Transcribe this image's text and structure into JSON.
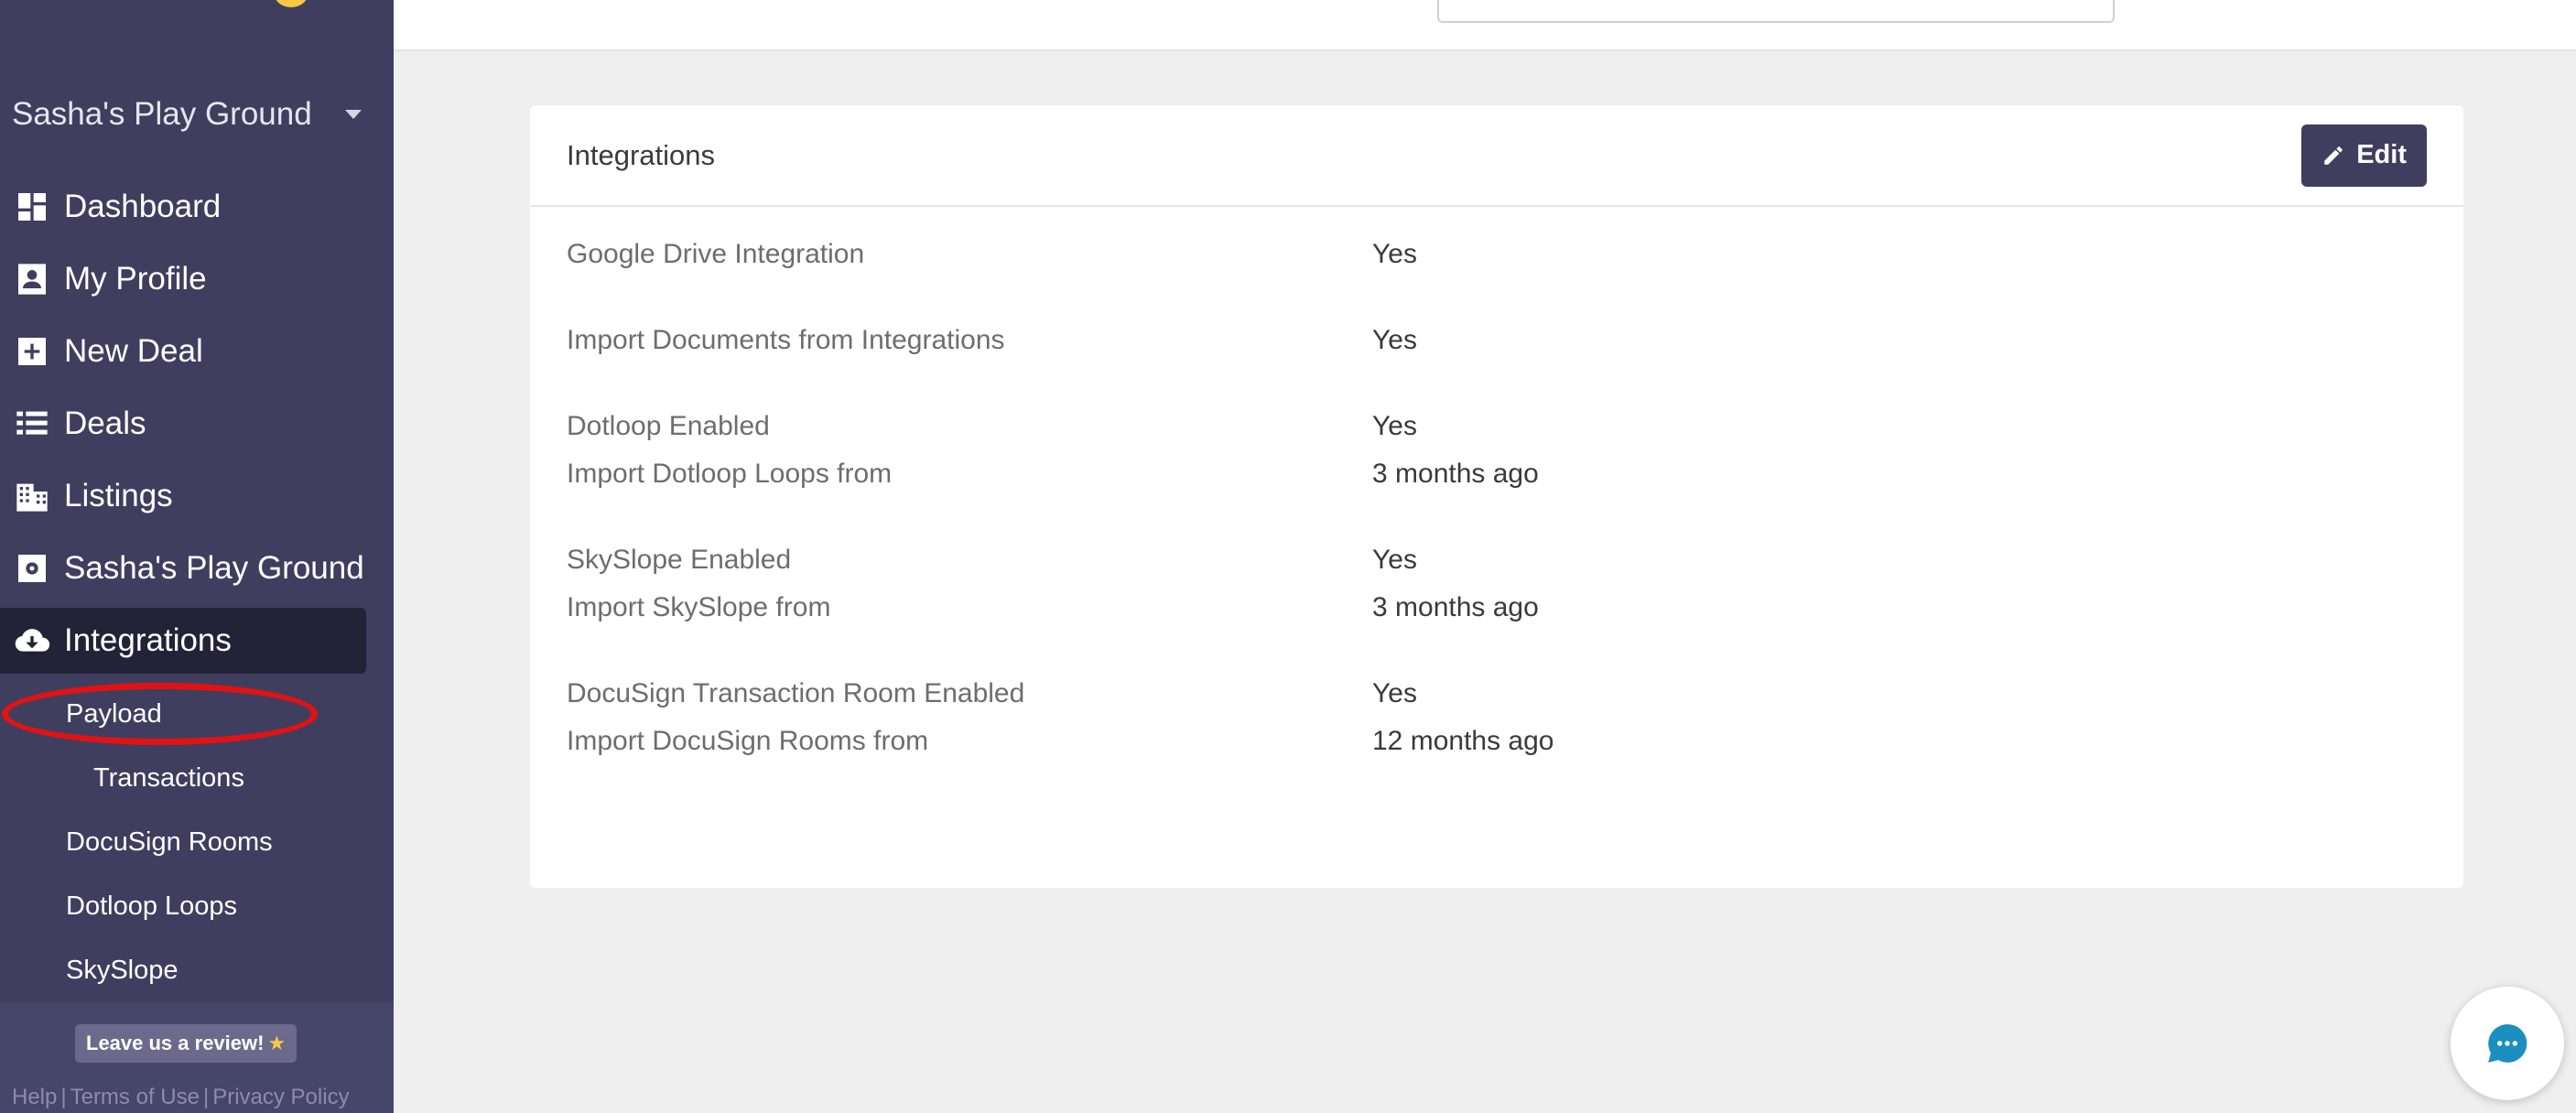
{
  "sidebar": {
    "workspace": "Sasha's Play Ground",
    "nav": [
      {
        "label": "Dashboard",
        "icon": "dashboard-icon"
      },
      {
        "label": "My Profile",
        "icon": "profile-icon"
      },
      {
        "label": "New Deal",
        "icon": "plus-icon"
      },
      {
        "label": "Deals",
        "icon": "list-icon"
      },
      {
        "label": "Listings",
        "icon": "building-icon"
      },
      {
        "label": "Sasha's Play Ground",
        "icon": "gear-icon"
      },
      {
        "label": "Integrations",
        "icon": "cloud-download-icon",
        "active": true
      }
    ],
    "subnav": {
      "payload": "Payload",
      "transactions": "Transactions",
      "docusign": "DocuSign Rooms",
      "dotloop": "Dotloop Loops",
      "skyslope": "SkySlope"
    },
    "footer": {
      "review": "Leave us a review!",
      "help": "Help",
      "terms": "Terms of Use",
      "privacy": "Privacy Policy"
    }
  },
  "card": {
    "title": "Integrations",
    "edit_label": "Edit",
    "rows": [
      {
        "key": "Google Drive Integration",
        "value": "Yes"
      },
      {
        "key": "Import Documents from Integrations",
        "value": "Yes"
      },
      {
        "key": "Dotloop Enabled",
        "value": "Yes"
      },
      {
        "key": "Import Dotloop Loops from",
        "value": "3 months ago"
      },
      {
        "key": "SkySlope Enabled",
        "value": "Yes"
      },
      {
        "key": "Import SkySlope from",
        "value": "3 months ago"
      },
      {
        "key": "DocuSign Transaction Room Enabled",
        "value": "Yes"
      },
      {
        "key": "Import DocuSign Rooms from",
        "value": "12 months ago"
      }
    ]
  },
  "colors": {
    "sidebar_bg": "#3f3e5f",
    "active_bg": "#232236",
    "accent": "#f6c944",
    "highlight": "#e31212",
    "chat": "#1b8fc0"
  }
}
